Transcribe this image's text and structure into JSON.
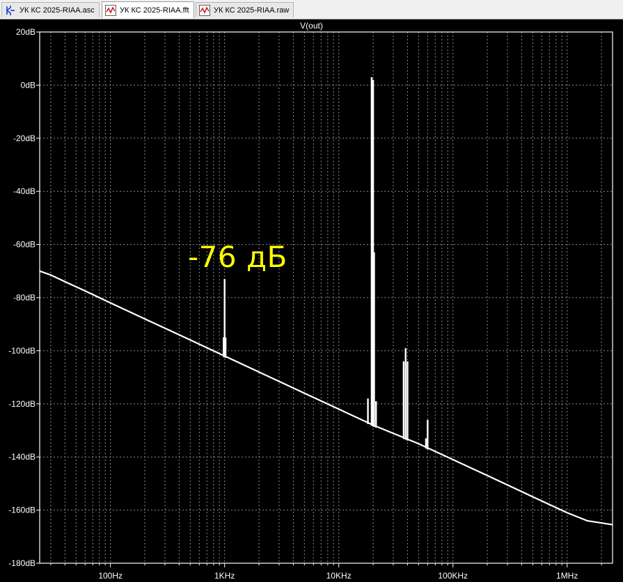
{
  "tabs": [
    {
      "label": "УК КС 2025-RIAA.asc",
      "icon": "schematic-icon",
      "active": false
    },
    {
      "label": "УК КС 2025-RIAA.fft",
      "icon": "waveform-icon",
      "active": true
    },
    {
      "label": "УК КС 2025-RIAA.raw",
      "icon": "waveform-icon",
      "active": false
    }
  ],
  "plot": {
    "title": "V(out)",
    "annotation": "-76 дБ",
    "background": "#000000",
    "trace_color": "#ffffff",
    "annotation_color": "#ffff00"
  },
  "chart_data": {
    "type": "line",
    "title": "V(out)",
    "xscale": "log",
    "xlim": [
      24,
      2500000
    ],
    "ylim": [
      -180,
      20
    ],
    "grid": true,
    "x_ticks": [
      {
        "value": 100,
        "label": "100Hz"
      },
      {
        "value": 1000,
        "label": "1KHz"
      },
      {
        "value": 10000,
        "label": "10KHz"
      },
      {
        "value": 100000,
        "label": "100KHz"
      },
      {
        "value": 1000000,
        "label": "1MHz"
      }
    ],
    "y_ticks": [
      {
        "value": 20,
        "label": "20dB"
      },
      {
        "value": 0,
        "label": "0dB"
      },
      {
        "value": -20,
        "label": "-20dB"
      },
      {
        "value": -40,
        "label": "-40dB"
      },
      {
        "value": -60,
        "label": "-60dB"
      },
      {
        "value": -80,
        "label": "-80dB"
      },
      {
        "value": -100,
        "label": "-100dB"
      },
      {
        "value": -120,
        "label": "-120dB"
      },
      {
        "value": -140,
        "label": "-140dB"
      },
      {
        "value": -160,
        "label": "-160dB"
      },
      {
        "value": -180,
        "label": "-180dB"
      }
    ],
    "series": [
      {
        "noise_floor": [
          [
            24,
            -70
          ],
          [
            30,
            -71.5
          ],
          [
            40,
            -74
          ],
          [
            60,
            -77.5
          ],
          [
            100,
            -82
          ],
          [
            200,
            -88
          ],
          [
            400,
            -94
          ],
          [
            1000,
            -102
          ],
          [
            2000,
            -108
          ],
          [
            5000,
            -116
          ],
          [
            10000,
            -122
          ],
          [
            20000,
            -128
          ],
          [
            50000,
            -135
          ],
          [
            100000,
            -141
          ],
          [
            200000,
            -147
          ],
          [
            500000,
            -155
          ],
          [
            1000000,
            -161
          ],
          [
            1500000,
            -164
          ],
          [
            2500000,
            -165.5
          ]
        ],
        "spikes": [
          {
            "x": 1000,
            "peak": -73
          },
          {
            "x": 980,
            "peak": -95
          },
          {
            "x": 1020,
            "peak": -95
          },
          {
            "x": 18000,
            "peak": -118
          },
          {
            "x": 19400,
            "peak": 3
          },
          {
            "x": 20000,
            "peak": 2
          },
          {
            "x": 20400,
            "peak": -63
          },
          {
            "x": 21200,
            "peak": -119
          },
          {
            "x": 37000,
            "peak": -104
          },
          {
            "x": 38500,
            "peak": -99
          },
          {
            "x": 40000,
            "peak": -104
          },
          {
            "x": 58000,
            "peak": -133
          },
          {
            "x": 60000,
            "peak": -126
          }
        ]
      }
    ]
  }
}
